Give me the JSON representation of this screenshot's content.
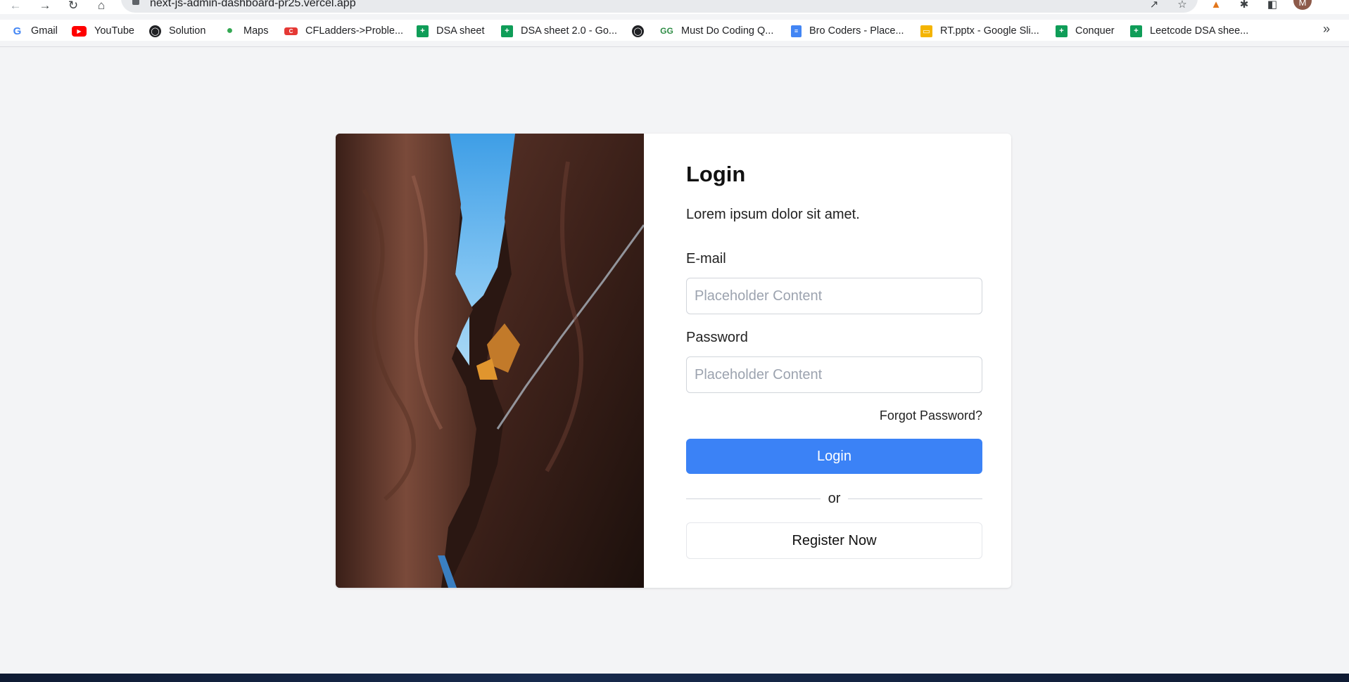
{
  "browser": {
    "url": "next-js-admin-dashboard-pr25.vercel.app",
    "avatar_initial": "M",
    "bookmarks": [
      {
        "label": "Gmail",
        "icon": "google-icon",
        "color": "#4285f4"
      },
      {
        "label": "YouTube",
        "icon": "youtube-icon",
        "color": "#ff0000"
      },
      {
        "label": "Solution",
        "icon": "globe-icon",
        "color": "#202124"
      },
      {
        "label": "Maps",
        "icon": "maps-pin-icon",
        "color": "#34a853"
      },
      {
        "label": "CFLadders->Proble...",
        "icon": "cfladders-icon",
        "color": "#e53935"
      },
      {
        "label": "DSA sheet",
        "icon": "sheets-icon",
        "color": "#0f9d58"
      },
      {
        "label": "DSA sheet 2.0 - Go...",
        "icon": "sheets-icon",
        "color": "#0f9d58"
      },
      {
        "label": "",
        "icon": "globe-icon",
        "color": "#202124"
      },
      {
        "label": "Must Do Coding Q...",
        "icon": "gfg-icon",
        "color": "#2f8d46"
      },
      {
        "label": "Bro Coders - Place...",
        "icon": "docs-icon",
        "color": "#4285f4"
      },
      {
        "label": "RT.pptx - Google Sli...",
        "icon": "slides-icon",
        "color": "#f4b400"
      },
      {
        "label": "Conquer",
        "icon": "sheets-icon",
        "color": "#0f9d58"
      },
      {
        "label": "Leetcode DSA shee...",
        "icon": "sheets-icon",
        "color": "#0f9d58"
      }
    ],
    "more_label": "»"
  },
  "login": {
    "title": "Login",
    "subtitle": "Lorem ipsum dolor sit amet.",
    "email_label": "E-mail",
    "email_placeholder": "Placeholder Content",
    "password_label": "Password",
    "password_placeholder": "Placeholder Content",
    "forgot_label": "Forgot Password?",
    "login_button": "Login",
    "divider_text": "or",
    "register_button": "Register Now"
  },
  "colors": {
    "page_background": "#f3f4f6",
    "primary_button": "#3b82f6",
    "card_background": "#ffffff"
  }
}
